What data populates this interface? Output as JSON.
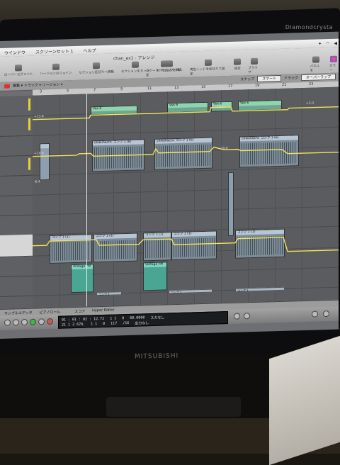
{
  "monitor": {
    "brand": "MITSUBISHI",
    "top_brand": "Diamondcrysta"
  },
  "menubar": {
    "items": [
      "ウインドウ",
      "スクリーンセット 1",
      "ヘルプ"
    ]
  },
  "window": {
    "title": "chan_ex1 - アレンジ"
  },
  "toolbar": {
    "items": [
      "ローパーセグメント",
      "リージョンのジョイン",
      "セクション区切りへ移動",
      "セクションをカット",
      "セクションを挿入"
    ],
    "right_items": [
      "ロケーターを区切りで設定",
      "再生ヘッドを区切りで設定",
      "設定",
      "ブラウザ",
      "パネルを",
      "カラー"
    ]
  },
  "controlbar": {
    "edit_label": "編集",
    "track_label": "トラック",
    "region_label": "リージョン",
    "snap_label": "スナップ",
    "snap_value": "スマート",
    "drag_label": "ドラッグ",
    "drag_value": "オーバーラップ"
  },
  "ruler": {
    "marks": [
      "3",
      "5",
      "7",
      "9",
      "11",
      "13",
      "15",
      "17",
      "19",
      "21",
      "23"
    ]
  },
  "regions": [
    {
      "label": "Vox 6"
    },
    {
      "label": "Vox 6"
    },
    {
      "label": "Vox 6"
    },
    {
      "label": "Vox 6"
    },
    {
      "label": "chikuhachi: コンプ 1 (6)"
    },
    {
      "label": "chikuhachi: コンプ 1 (6)"
    },
    {
      "label": "chikuhachi: コンプ 1 (6)"
    },
    {
      "label": "コンプ 1 (1)"
    },
    {
      "label": "コンプ 1 (1)"
    },
    {
      "label": "コンプ 1 (1)"
    },
    {
      "label": "コンプ 1 (1)"
    },
    {
      "label": "コンプ 1 (1)"
    }
  ],
  "pills": [
    "Vintage FM",
    "Vintage FM",
    "コンプ 1",
    "コンプ 1",
    "コンプ 1"
  ],
  "scale_labels": [
    "+13.8",
    "+10.8",
    "-10.0",
    "-6.4",
    "+2.0",
    "+3.0"
  ],
  "bottombar": {
    "items": [
      "サンプルエディタ",
      "ピアノロール",
      "スコア",
      "Hyper Editor"
    ]
  },
  "lcd": {
    "row1": [
      "01 : 01 : 02 : 12.72",
      "1  1",
      "0",
      "60.0000",
      "スカなし"
    ],
    "row2": [
      "21  1  3  670.",
      "1  1",
      "0",
      "117",
      "/16",
      "出力なし"
    ]
  }
}
